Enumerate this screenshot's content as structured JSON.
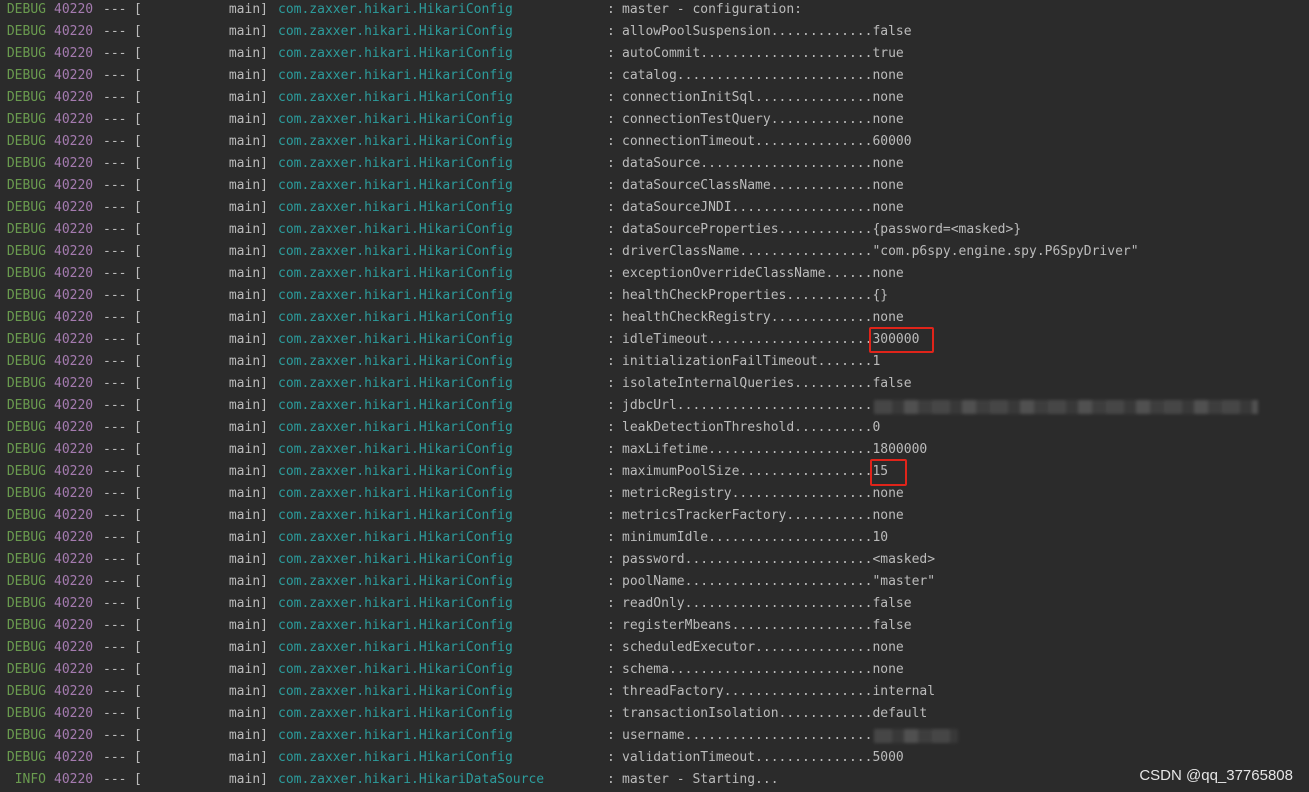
{
  "lines": [
    {
      "level": "DEBUG",
      "pid": "40220",
      "sep": "---",
      "bracket": "[",
      "thread": "main]",
      "logger": "com.zaxxer.hikari.HikariConfig",
      "colon": ":",
      "message": "master - configuration:"
    },
    {
      "level": "DEBUG",
      "pid": "40220",
      "sep": "---",
      "bracket": "[",
      "thread": "main]",
      "logger": "com.zaxxer.hikari.HikariConfig",
      "colon": ":",
      "message": "allowPoolSuspension.............false"
    },
    {
      "level": "DEBUG",
      "pid": "40220",
      "sep": "---",
      "bracket": "[",
      "thread": "main]",
      "logger": "com.zaxxer.hikari.HikariConfig",
      "colon": ":",
      "message": "autoCommit......................true"
    },
    {
      "level": "DEBUG",
      "pid": "40220",
      "sep": "---",
      "bracket": "[",
      "thread": "main]",
      "logger": "com.zaxxer.hikari.HikariConfig",
      "colon": ":",
      "message": "catalog.........................none"
    },
    {
      "level": "DEBUG",
      "pid": "40220",
      "sep": "---",
      "bracket": "[",
      "thread": "main]",
      "logger": "com.zaxxer.hikari.HikariConfig",
      "colon": ":",
      "message": "connectionInitSql...............none"
    },
    {
      "level": "DEBUG",
      "pid": "40220",
      "sep": "---",
      "bracket": "[",
      "thread": "main]",
      "logger": "com.zaxxer.hikari.HikariConfig",
      "colon": ":",
      "message": "connectionTestQuery.............none"
    },
    {
      "level": "DEBUG",
      "pid": "40220",
      "sep": "---",
      "bracket": "[",
      "thread": "main]",
      "logger": "com.zaxxer.hikari.HikariConfig",
      "colon": ":",
      "message": "connectionTimeout...............60000"
    },
    {
      "level": "DEBUG",
      "pid": "40220",
      "sep": "---",
      "bracket": "[",
      "thread": "main]",
      "logger": "com.zaxxer.hikari.HikariConfig",
      "colon": ":",
      "message": "dataSource......................none"
    },
    {
      "level": "DEBUG",
      "pid": "40220",
      "sep": "---",
      "bracket": "[",
      "thread": "main]",
      "logger": "com.zaxxer.hikari.HikariConfig",
      "colon": ":",
      "message": "dataSourceClassName.............none"
    },
    {
      "level": "DEBUG",
      "pid": "40220",
      "sep": "---",
      "bracket": "[",
      "thread": "main]",
      "logger": "com.zaxxer.hikari.HikariConfig",
      "colon": ":",
      "message": "dataSourceJNDI..................none"
    },
    {
      "level": "DEBUG",
      "pid": "40220",
      "sep": "---",
      "bracket": "[",
      "thread": "main]",
      "logger": "com.zaxxer.hikari.HikariConfig",
      "colon": ":",
      "message": "dataSourceProperties............{password=<masked>}"
    },
    {
      "level": "DEBUG",
      "pid": "40220",
      "sep": "---",
      "bracket": "[",
      "thread": "main]",
      "logger": "com.zaxxer.hikari.HikariConfig",
      "colon": ":",
      "message": "driverClassName.................\"com.p6spy.engine.spy.P6SpyDriver\""
    },
    {
      "level": "DEBUG",
      "pid": "40220",
      "sep": "---",
      "bracket": "[",
      "thread": "main]",
      "logger": "com.zaxxer.hikari.HikariConfig",
      "colon": ":",
      "message": "exceptionOverrideClassName......none"
    },
    {
      "level": "DEBUG",
      "pid": "40220",
      "sep": "---",
      "bracket": "[",
      "thread": "main]",
      "logger": "com.zaxxer.hikari.HikariConfig",
      "colon": ":",
      "message": "healthCheckProperties...........{}"
    },
    {
      "level": "DEBUG",
      "pid": "40220",
      "sep": "---",
      "bracket": "[",
      "thread": "main]",
      "logger": "com.zaxxer.hikari.HikariConfig",
      "colon": ":",
      "message": "healthCheckRegistry.............none"
    },
    {
      "level": "DEBUG",
      "pid": "40220",
      "sep": "---",
      "bracket": "[",
      "thread": "main]",
      "logger": "com.zaxxer.hikari.HikariConfig",
      "colon": ":",
      "message": "idleTimeout.....................300000"
    },
    {
      "level": "DEBUG",
      "pid": "40220",
      "sep": "---",
      "bracket": "[",
      "thread": "main]",
      "logger": "com.zaxxer.hikari.HikariConfig",
      "colon": ":",
      "message": "initializationFailTimeout.......1"
    },
    {
      "level": "DEBUG",
      "pid": "40220",
      "sep": "---",
      "bracket": "[",
      "thread": "main]",
      "logger": "com.zaxxer.hikari.HikariConfig",
      "colon": ":",
      "message": "isolateInternalQueries..........false"
    },
    {
      "level": "DEBUG",
      "pid": "40220",
      "sep": "---",
      "bracket": "[",
      "thread": "main]",
      "logger": "com.zaxxer.hikari.HikariConfig",
      "colon": ":",
      "message": "jdbcUrl........................."
    },
    {
      "level": "DEBUG",
      "pid": "40220",
      "sep": "---",
      "bracket": "[",
      "thread": "main]",
      "logger": "com.zaxxer.hikari.HikariConfig",
      "colon": ":",
      "message": "leakDetectionThreshold..........0"
    },
    {
      "level": "DEBUG",
      "pid": "40220",
      "sep": "---",
      "bracket": "[",
      "thread": "main]",
      "logger": "com.zaxxer.hikari.HikariConfig",
      "colon": ":",
      "message": "maxLifetime.....................1800000"
    },
    {
      "level": "DEBUG",
      "pid": "40220",
      "sep": "---",
      "bracket": "[",
      "thread": "main]",
      "logger": "com.zaxxer.hikari.HikariConfig",
      "colon": ":",
      "message": "maximumPoolSize.................15"
    },
    {
      "level": "DEBUG",
      "pid": "40220",
      "sep": "---",
      "bracket": "[",
      "thread": "main]",
      "logger": "com.zaxxer.hikari.HikariConfig",
      "colon": ":",
      "message": "metricRegistry..................none"
    },
    {
      "level": "DEBUG",
      "pid": "40220",
      "sep": "---",
      "bracket": "[",
      "thread": "main]",
      "logger": "com.zaxxer.hikari.HikariConfig",
      "colon": ":",
      "message": "metricsTrackerFactory...........none"
    },
    {
      "level": "DEBUG",
      "pid": "40220",
      "sep": "---",
      "bracket": "[",
      "thread": "main]",
      "logger": "com.zaxxer.hikari.HikariConfig",
      "colon": ":",
      "message": "minimumIdle.....................10"
    },
    {
      "level": "DEBUG",
      "pid": "40220",
      "sep": "---",
      "bracket": "[",
      "thread": "main]",
      "logger": "com.zaxxer.hikari.HikariConfig",
      "colon": ":",
      "message": "password........................<masked>"
    },
    {
      "level": "DEBUG",
      "pid": "40220",
      "sep": "---",
      "bracket": "[",
      "thread": "main]",
      "logger": "com.zaxxer.hikari.HikariConfig",
      "colon": ":",
      "message": "poolName........................\"master\""
    },
    {
      "level": "DEBUG",
      "pid": "40220",
      "sep": "---",
      "bracket": "[",
      "thread": "main]",
      "logger": "com.zaxxer.hikari.HikariConfig",
      "colon": ":",
      "message": "readOnly........................false"
    },
    {
      "level": "DEBUG",
      "pid": "40220",
      "sep": "---",
      "bracket": "[",
      "thread": "main]",
      "logger": "com.zaxxer.hikari.HikariConfig",
      "colon": ":",
      "message": "registerMbeans..................false"
    },
    {
      "level": "DEBUG",
      "pid": "40220",
      "sep": "---",
      "bracket": "[",
      "thread": "main]",
      "logger": "com.zaxxer.hikari.HikariConfig",
      "colon": ":",
      "message": "scheduledExecutor...............none"
    },
    {
      "level": "DEBUG",
      "pid": "40220",
      "sep": "---",
      "bracket": "[",
      "thread": "main]",
      "logger": "com.zaxxer.hikari.HikariConfig",
      "colon": ":",
      "message": "schema..........................none"
    },
    {
      "level": "DEBUG",
      "pid": "40220",
      "sep": "---",
      "bracket": "[",
      "thread": "main]",
      "logger": "com.zaxxer.hikari.HikariConfig",
      "colon": ":",
      "message": "threadFactory...................internal"
    },
    {
      "level": "DEBUG",
      "pid": "40220",
      "sep": "---",
      "bracket": "[",
      "thread": "main]",
      "logger": "com.zaxxer.hikari.HikariConfig",
      "colon": ":",
      "message": "transactionIsolation............default"
    },
    {
      "level": "DEBUG",
      "pid": "40220",
      "sep": "---",
      "bracket": "[",
      "thread": "main]",
      "logger": "com.zaxxer.hikari.HikariConfig",
      "colon": ":",
      "message": "username........................"
    },
    {
      "level": "DEBUG",
      "pid": "40220",
      "sep": "---",
      "bracket": "[",
      "thread": "main]",
      "logger": "com.zaxxer.hikari.HikariConfig",
      "colon": ":",
      "message": "validationTimeout...............5000"
    },
    {
      "level": "INFO",
      "pid": "40220",
      "sep": "---",
      "bracket": "[",
      "thread": "main]",
      "logger": "com.zaxxer.hikari.HikariDataSource",
      "colon": ":",
      "message": "master - Starting..."
    }
  ],
  "watermark": "CSDN @qq_37765808",
  "colors": {
    "background": "#2b2b2b",
    "level": "#6a9b4f",
    "pid": "#a57bb0",
    "logger": "#2c9c9c",
    "text": "#bbbbbb",
    "highlight_box": "#e0241a"
  }
}
